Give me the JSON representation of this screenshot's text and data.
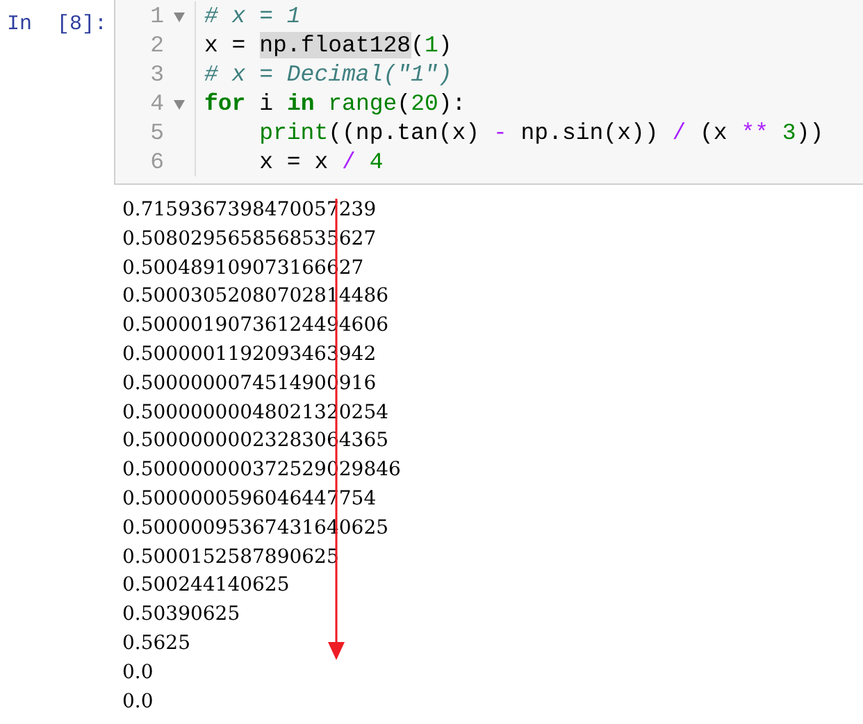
{
  "prompt": "In  [8]:",
  "code": {
    "lines": [
      {
        "number": "1",
        "foldable": true,
        "tokens": [
          {
            "kind": "comment",
            "text": "# x = 1"
          }
        ]
      },
      {
        "number": "2",
        "foldable": false,
        "tokens": [
          {
            "kind": "plain",
            "text": "x = "
          },
          {
            "kind": "highlight",
            "text": "np.float128"
          },
          {
            "kind": "plain",
            "text": "("
          },
          {
            "kind": "number",
            "text": "1"
          },
          {
            "kind": "plain",
            "text": ")"
          }
        ]
      },
      {
        "number": "3",
        "foldable": false,
        "tokens": [
          {
            "kind": "comment",
            "text": "# x = Decimal(\"1\")"
          }
        ]
      },
      {
        "number": "4",
        "foldable": true,
        "tokens": [
          {
            "kind": "keyword",
            "text": "for"
          },
          {
            "kind": "plain",
            "text": " i "
          },
          {
            "kind": "keyword",
            "text": "in"
          },
          {
            "kind": "builtin",
            "text": " range"
          },
          {
            "kind": "plain",
            "text": "("
          },
          {
            "kind": "number",
            "text": "20"
          },
          {
            "kind": "plain",
            "text": "):"
          }
        ]
      },
      {
        "number": "5",
        "foldable": false,
        "tokens": [
          {
            "kind": "builtin",
            "text": "    print"
          },
          {
            "kind": "plain",
            "text": "((np.tan(x) "
          },
          {
            "kind": "operator",
            "text": "-"
          },
          {
            "kind": "plain",
            "text": " np.sin(x)) "
          },
          {
            "kind": "operator",
            "text": "/"
          },
          {
            "kind": "plain",
            "text": " (x "
          },
          {
            "kind": "operator",
            "text": "** "
          },
          {
            "kind": "number",
            "text": "3"
          },
          {
            "kind": "plain",
            "text": "))"
          }
        ]
      },
      {
        "number": "6",
        "foldable": false,
        "tokens": [
          {
            "kind": "plain",
            "text": "    x = x "
          },
          {
            "kind": "operator",
            "text": "/ "
          },
          {
            "kind": "number",
            "text": "4"
          }
        ]
      }
    ]
  },
  "output": {
    "lines": [
      "0.7159367398470057239",
      "0.5080295658568535627",
      "0.500489109073166627",
      "0.50003052080702814486",
      "0.50000190736124494606",
      "0.5000001192093463942",
      "0.5000000074514900916",
      "0.50000000048021320254",
      "0.50000000023283064365",
      "0.500000000372529029846",
      "0.5000000596046447754",
      "0.50000095367431640625",
      "0.5000152587890625",
      "0.500244140625",
      "0.50390625",
      "0.5625",
      "0.0",
      "0.0"
    ]
  }
}
